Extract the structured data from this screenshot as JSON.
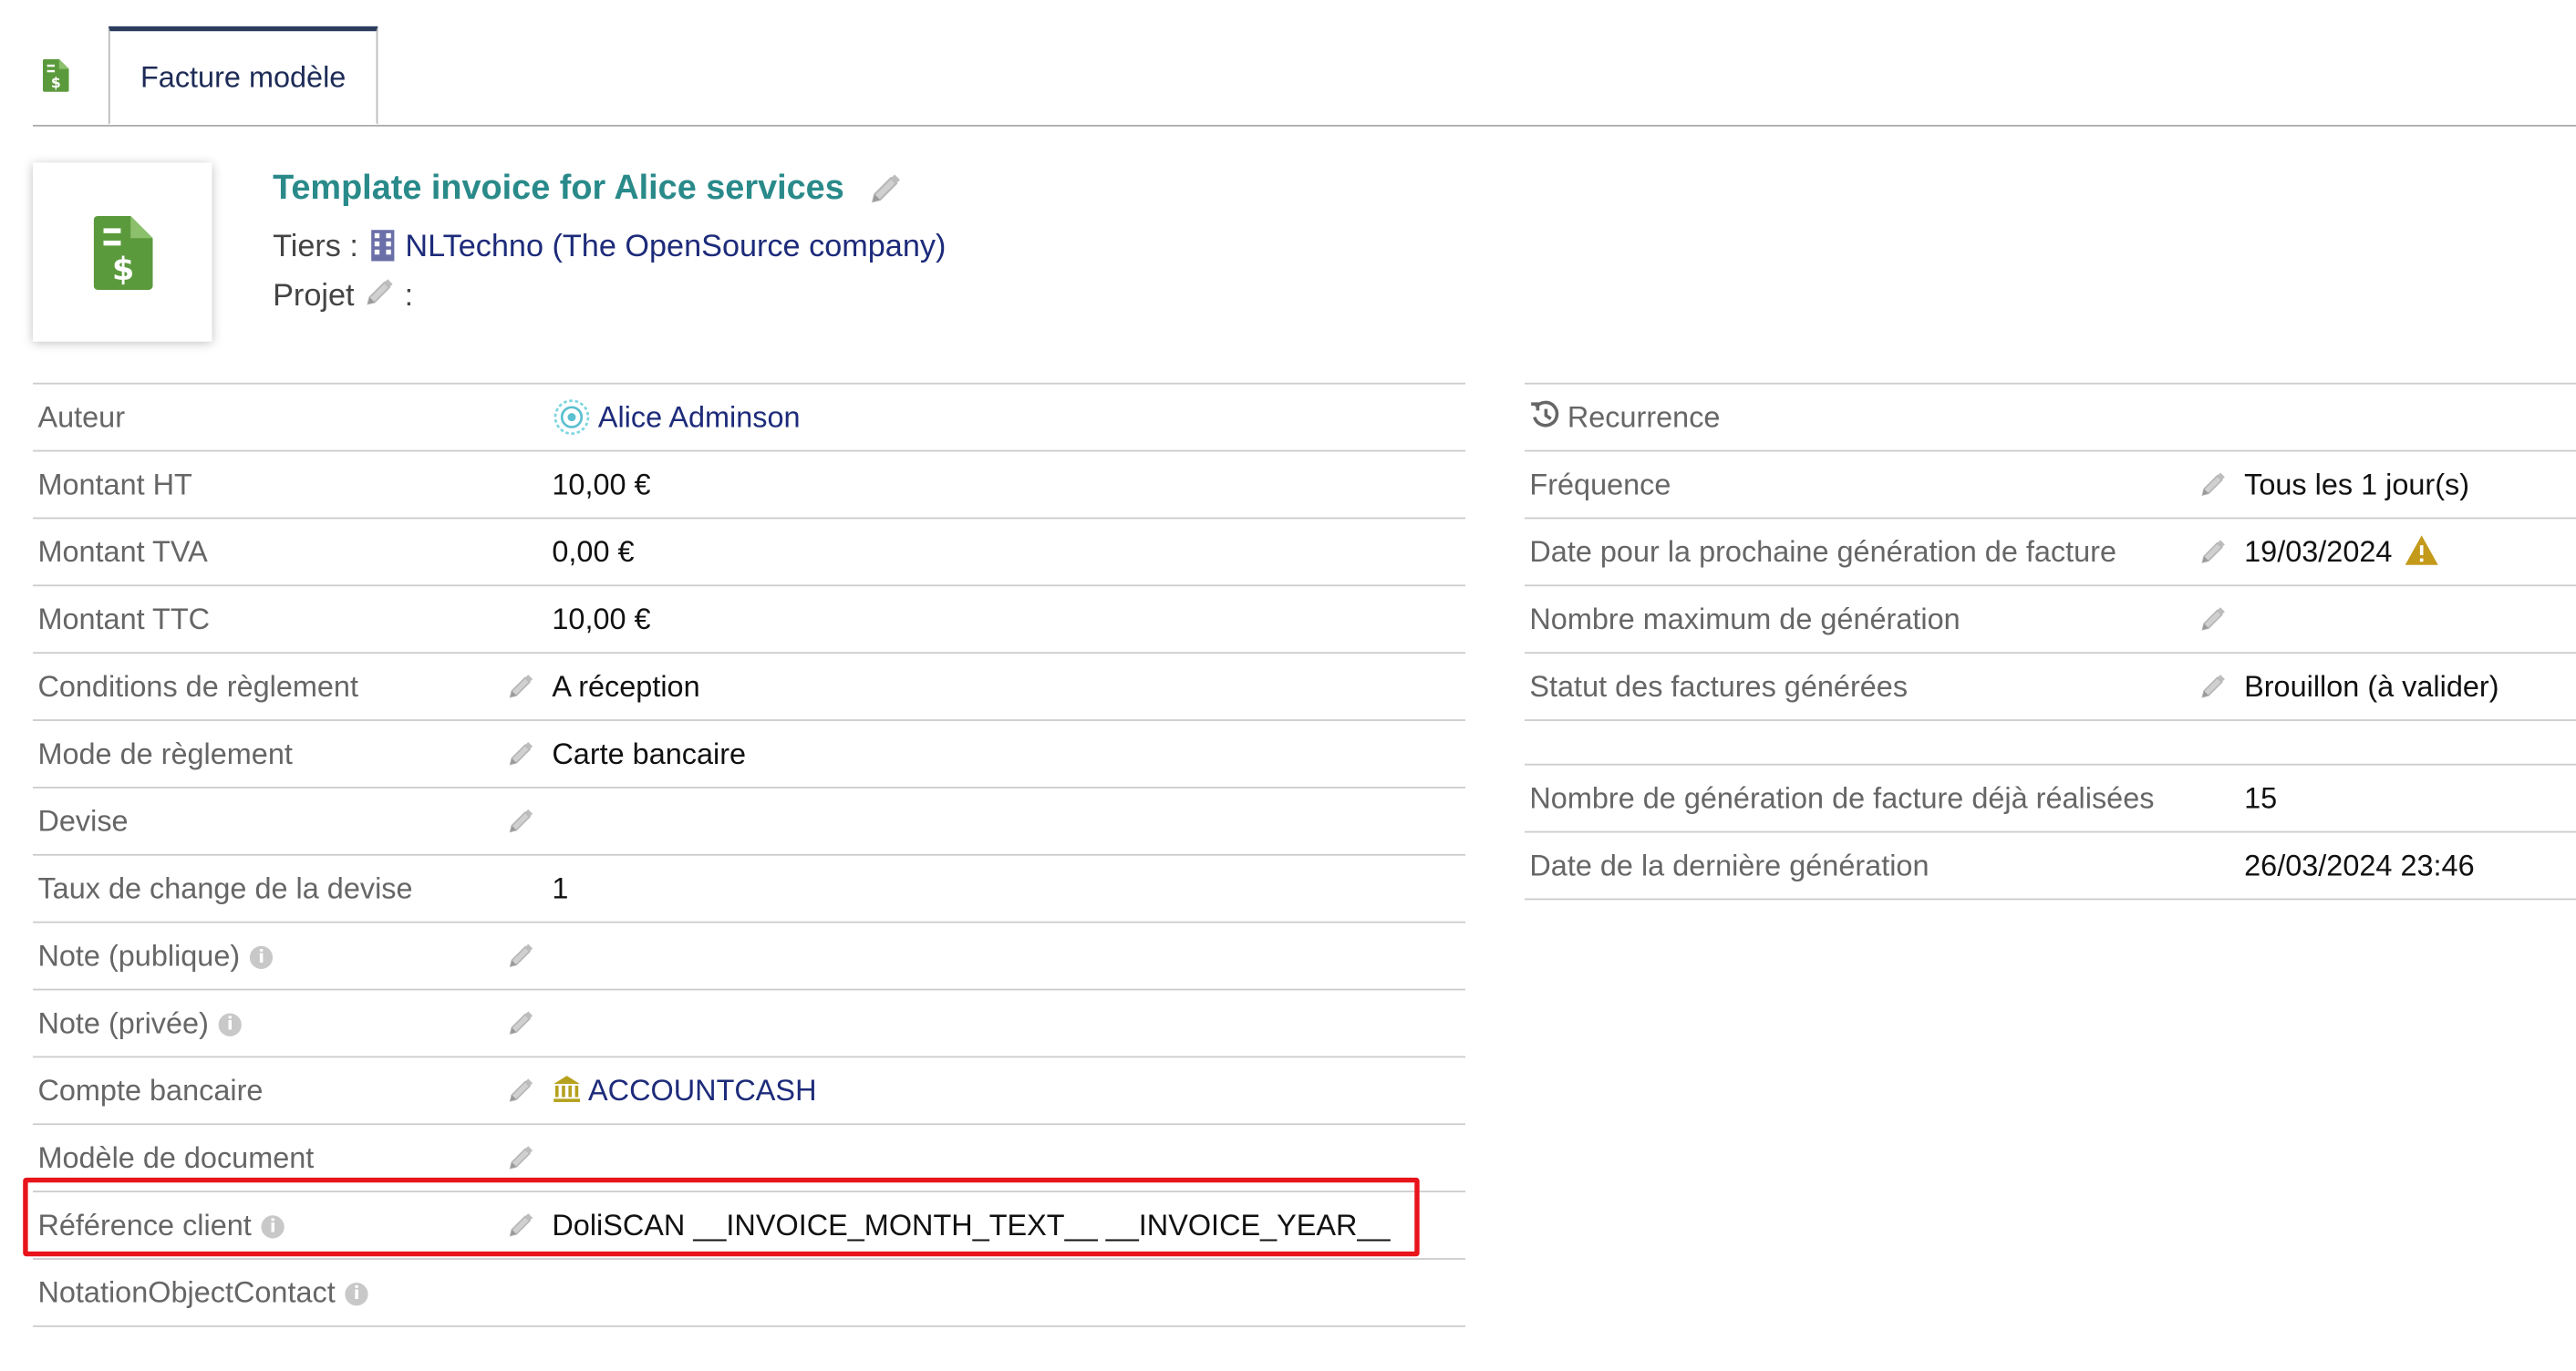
{
  "tabs": {
    "active_label": "Facture modèle"
  },
  "header": {
    "title": "Template invoice for Alice services",
    "tiers_label": "Tiers :",
    "tiers_value": "NLTechno (The OpenSource company)",
    "projet_label": "Projet",
    "projet_suffix": ":"
  },
  "left_table": {
    "rows": [
      {
        "label": "Auteur",
        "value": "Alice Adminson"
      },
      {
        "label": "Montant HT",
        "value": "10,00 €"
      },
      {
        "label": "Montant TVA",
        "value": "0,00 €"
      },
      {
        "label": "Montant TTC",
        "value": "10,00 €"
      },
      {
        "label": "Conditions de règlement",
        "value": "A réception"
      },
      {
        "label": "Mode de règlement",
        "value": "Carte bancaire"
      },
      {
        "label": "Devise",
        "value": ""
      },
      {
        "label": "Taux de change de la devise",
        "value": "1"
      },
      {
        "label": "Note (publique)",
        "value": ""
      },
      {
        "label": "Note (privée)",
        "value": ""
      },
      {
        "label": "Compte bancaire",
        "value": "ACCOUNTCASH"
      },
      {
        "label": "Modèle de document",
        "value": ""
      },
      {
        "label": "Référence client",
        "value": "DoliSCAN __INVOICE_MONTH_TEXT__ __INVOICE_YEAR__"
      },
      {
        "label": "NotationObjectContact",
        "value": ""
      }
    ]
  },
  "right_table": {
    "section_title": "Recurrence",
    "rows": [
      {
        "label": "Fréquence",
        "value": "Tous les 1 jour(s)"
      },
      {
        "label": "Date pour la prochaine génération de facture",
        "value": "19/03/2024"
      },
      {
        "label": "Nombre maximum de génération",
        "value": ""
      },
      {
        "label": "Statut des factures générées",
        "value": "Brouillon (à valider)"
      }
    ],
    "rows2": [
      {
        "label": "Nombre de génération de facture déjà réalisées",
        "value": "15"
      },
      {
        "label": "Date de la dernière génération",
        "value": "26/03/2024 23:46"
      }
    ]
  },
  "colors": {
    "title": "#2a8a8a",
    "link": "#1d2b7a",
    "invoice_icon": "#5b9a3c",
    "highlight": "#e8141b",
    "warning": "#c49a1b"
  },
  "icons": [
    "invoice-icon",
    "pencil-icon",
    "building-icon",
    "user-avatar-icon",
    "bank-icon",
    "history-icon",
    "warning-icon",
    "info-icon"
  ]
}
